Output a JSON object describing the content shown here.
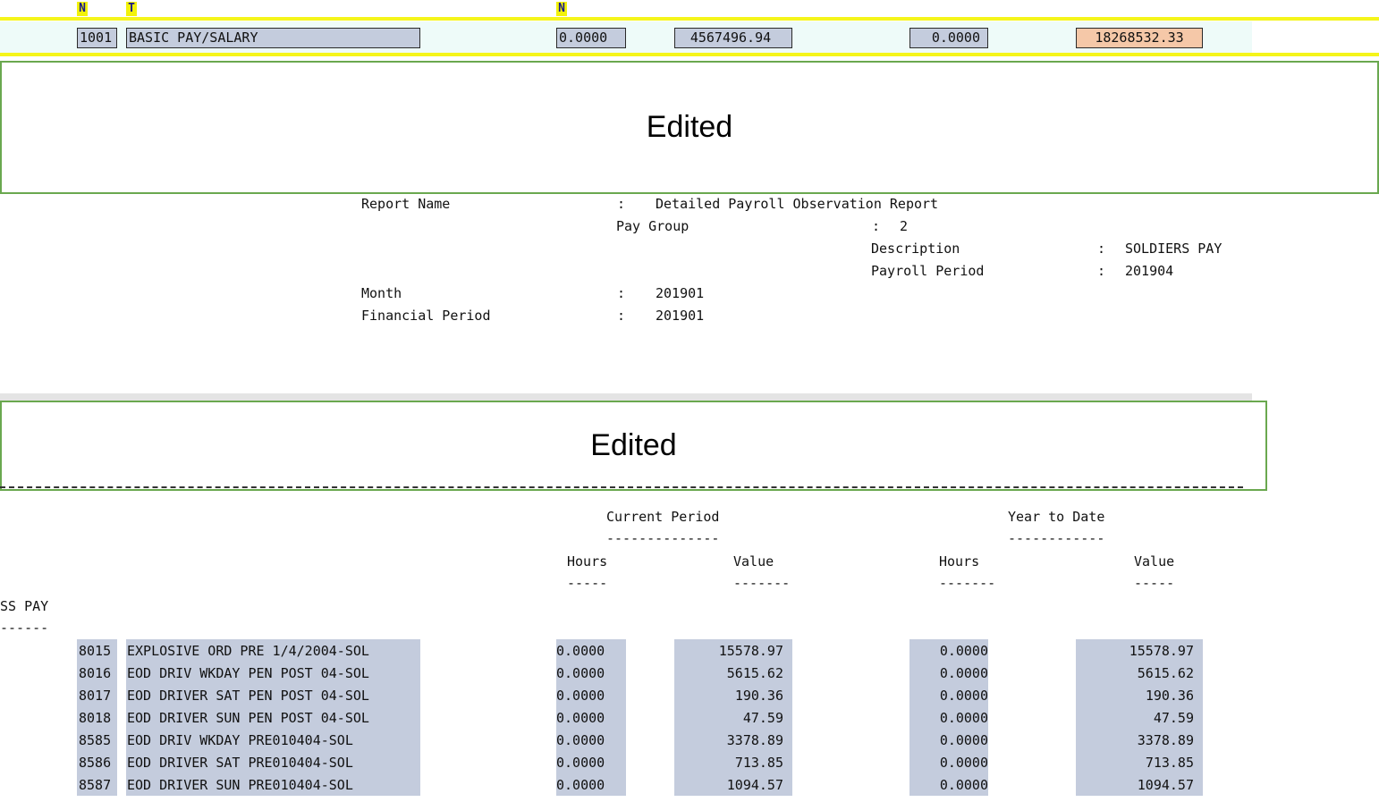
{
  "top_flags": [
    "N",
    "T",
    "N"
  ],
  "top_row": {
    "code": "1001",
    "description": "BASIC PAY/SALARY",
    "cp_hours": "0.0000",
    "cp_value": "4567496.94",
    "ytd_hours": "0.0000",
    "ytd_value": "18268532.33"
  },
  "edited_label_1": "Edited",
  "edited_label_2": "Edited",
  "report_header": {
    "report_name_label": "Report Name",
    "report_name_value": "Detailed Payroll Observation Report",
    "pay_group_label": "Pay Group",
    "pay_group_value": "2",
    "description_label": "Description",
    "description_value": "SOLDIERS PAY",
    "payroll_period_label": "Payroll Period",
    "payroll_period_value": "201904",
    "month_label": "Month",
    "month_value": "201901",
    "financial_period_label": "Financial Period",
    "financial_period_value": "201901",
    "colon": ":"
  },
  "columns": {
    "current_period": "Current Period",
    "current_period_underline": "--------------",
    "year_to_date": "Year to Date",
    "year_to_date_underline": "------------",
    "hours_1": "Hours",
    "hours_1_underline": "-----",
    "value_1": "Value",
    "value_1_underline": "-------",
    "hours_2": "Hours",
    "hours_2_underline": "-------",
    "value_2": "Value",
    "value_2_underline": "-----"
  },
  "section": {
    "title": "SS PAY",
    "underline": "------"
  },
  "rows": [
    {
      "code": "8015",
      "desc": "EXPLOSIVE ORD PRE 1/4/2004-SOL",
      "cp_hours": "0.0000",
      "cp_value": "15578.97",
      "ytd_hours": "0.0000",
      "ytd_value": "15578.97"
    },
    {
      "code": "8016",
      "desc": "EOD DRIV WKDAY PEN POST 04-SOL",
      "cp_hours": "0.0000",
      "cp_value": "5615.62",
      "ytd_hours": "0.0000",
      "ytd_value": "5615.62"
    },
    {
      "code": "8017",
      "desc": "EOD DRIVER SAT PEN POST 04-SOL",
      "cp_hours": "0.0000",
      "cp_value": "190.36",
      "ytd_hours": "0.0000",
      "ytd_value": "190.36"
    },
    {
      "code": "8018",
      "desc": "EOD DRIVER SUN PEN POST 04-SOL",
      "cp_hours": "0.0000",
      "cp_value": "47.59",
      "ytd_hours": "0.0000",
      "ytd_value": "47.59"
    },
    {
      "code": "8585",
      "desc": "EOD DRIV WKDAY PRE010404-SOL",
      "cp_hours": "0.0000",
      "cp_value": "3378.89",
      "ytd_hours": "0.0000",
      "ytd_value": "3378.89"
    },
    {
      "code": "8586",
      "desc": "EOD DRIVER SAT PRE010404-SOL",
      "cp_hours": "0.0000",
      "cp_value": "713.85",
      "ytd_hours": "0.0000",
      "ytd_value": "713.85"
    },
    {
      "code": "8587",
      "desc": "EOD DRIVER SUN PRE010404-SOL",
      "cp_hours": "0.0000",
      "cp_value": "1094.57",
      "ytd_hours": "0.0000",
      "ytd_value": "1094.57"
    }
  ]
}
